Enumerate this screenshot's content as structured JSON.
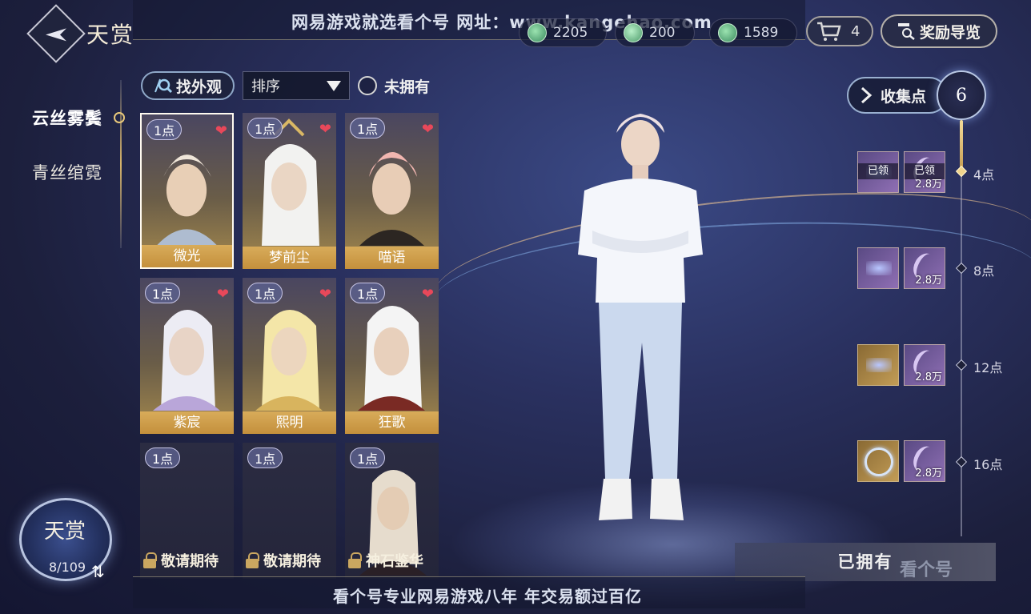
{
  "header": {
    "title": "天赏",
    "watermark_top": "网易游戏就选看个号  网址：www.kangehao.com",
    "currencies": [
      {
        "icon": "jade-coin-icon",
        "value": "2205"
      },
      {
        "icon": "jade-coin-icon",
        "value": "200"
      },
      {
        "icon": "jade-coin-icon",
        "value": "1589"
      }
    ],
    "cart_count": "4",
    "reward_guide": "奖励导览"
  },
  "sidebar": {
    "categories": [
      {
        "label": "云丝雾鬓",
        "active": true
      },
      {
        "label": "青丝绾霓",
        "active": false
      }
    ]
  },
  "filters": {
    "find_label": "找外观",
    "sort_label": "排序",
    "not_owned_label": "未拥有"
  },
  "grid": {
    "items": [
      {
        "points": "1点",
        "name": "微光",
        "favorite": true,
        "selected": true
      },
      {
        "points": "1点",
        "name": "梦前尘",
        "favorite": true
      },
      {
        "points": "1点",
        "name": "喵语",
        "favorite": true
      },
      {
        "points": "1点",
        "name": "紫宸",
        "favorite": true
      },
      {
        "points": "1点",
        "name": "熙明",
        "favorite": true
      },
      {
        "points": "1点",
        "name": "狂歌",
        "favorite": true
      },
      {
        "points": "1点",
        "name": "敬请期待",
        "locked": true
      },
      {
        "points": "1点",
        "name": "敬请期待",
        "locked": true
      },
      {
        "points": "1点",
        "name": "神石鉴华",
        "locked": true
      }
    ]
  },
  "collection": {
    "label": "收集点",
    "count": "6",
    "tiers": [
      {
        "label": "4点",
        "rewards": [
          {
            "claimed": "已领"
          },
          {
            "claimed": "已领",
            "amount": "2.8万"
          }
        ]
      },
      {
        "label": "8点",
        "rewards": [
          {},
          {
            "amount": "2.8万"
          }
        ]
      },
      {
        "label": "12点",
        "rewards": [
          {},
          {
            "amount": "2.8万"
          }
        ]
      },
      {
        "label": "16点",
        "rewards": [
          {},
          {
            "amount": "2.8万"
          }
        ]
      }
    ]
  },
  "footer": {
    "owned_label": "已拥有",
    "watermark_bottom": "看个号专业网易游戏八年  年交易额过百亿",
    "emblem_title": "天赏",
    "emblem_progress": "8/109",
    "brand": "看个号"
  },
  "colors": {
    "accent_gold": "#d8ac5a",
    "heart": "#e8485a",
    "background": "#1c1f3c"
  }
}
